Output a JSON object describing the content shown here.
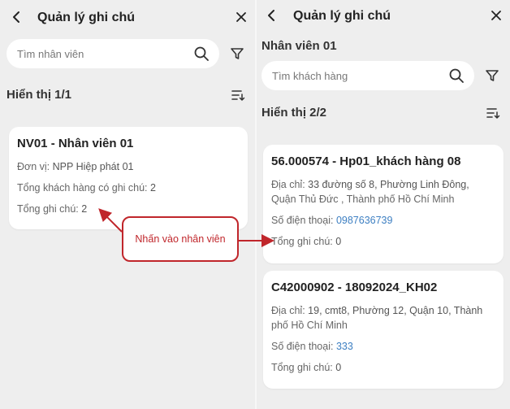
{
  "left": {
    "header": {
      "title": "Quản lý ghi chú"
    },
    "search": {
      "placeholder": "Tìm nhân viên"
    },
    "count_label": "Hiển thị 1/1",
    "employee_card": {
      "title": "NV01 - Nhân viên 01",
      "unit_label": "Đơn vị:",
      "unit_value": "NPP Hiệp phát 01",
      "customers_label": "Tổng khách hàng có ghi chú:",
      "customers_value": "2",
      "notes_label": "Tổng ghi chú:",
      "notes_value": "2"
    }
  },
  "right": {
    "header": {
      "title": "Quản lý ghi chú"
    },
    "employee_name": "Nhân viên 01",
    "search": {
      "placeholder": "Tìm khách hàng"
    },
    "count_label": "Hiển thị 2/2",
    "customers": [
      {
        "title": "56.000574 - Hp01_khách hàng 08",
        "address_label": "Địa chỉ:",
        "address_line1": "33 đường số 8, Phường Linh Đông,",
        "address_line2": "Quận Thủ Đức , Thành phố Hồ Chí Minh",
        "phone_label": "Số điện thoại:",
        "phone_value": "0987636739",
        "notes_label": "Tổng ghi chú:",
        "notes_value": "0"
      },
      {
        "title": "C42000902 - 18092024_KH02",
        "address_label": "Địa chỉ:",
        "address_line1": "19, cmt8, Phường 12, Quận 10, Thành",
        "address_line2": "phố Hồ Chí Minh",
        "phone_label": "Số điện thoại:",
        "phone_value": "333",
        "notes_label": "Tổng ghi chú:",
        "notes_value": "0"
      }
    ]
  },
  "annotation": {
    "callout_text": "Nhấn vào nhân viên"
  },
  "colors": {
    "accent_red": "#c0262b",
    "phone_blue": "#3d7fc2",
    "background": "#eeeeee"
  }
}
